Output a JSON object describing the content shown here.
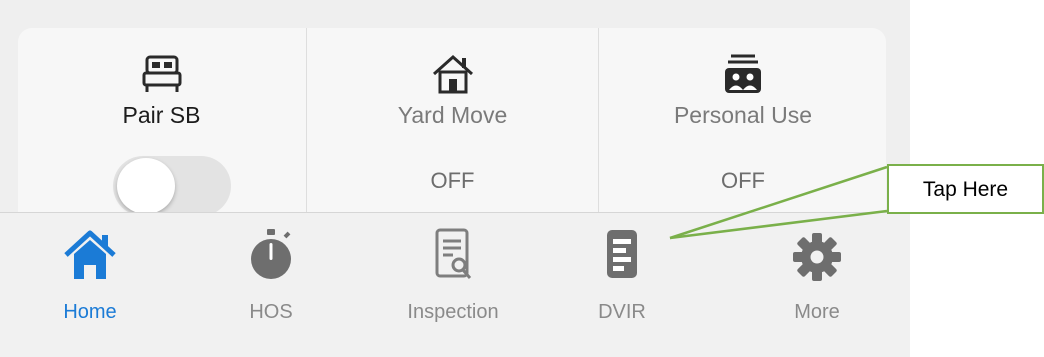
{
  "status_card": {
    "pair_sb": {
      "label": "Pair SB",
      "toggle_on": false,
      "icon": "bed-icon"
    },
    "yard_move": {
      "label": "Yard Move",
      "value": "OFF",
      "icon": "house-icon"
    },
    "personal_use": {
      "label": "Personal Use",
      "value": "OFF",
      "icon": "personal-use-icon"
    }
  },
  "tabbar": {
    "items": [
      {
        "label": "Home",
        "icon": "home-icon",
        "active": true
      },
      {
        "label": "HOS",
        "icon": "stopwatch-icon"
      },
      {
        "label": "Inspection",
        "icon": "inspection-icon"
      },
      {
        "label": "DVIR",
        "icon": "dvir-icon"
      },
      {
        "label": "More",
        "icon": "gear-icon"
      }
    ]
  },
  "callout": {
    "text": "Tap Here"
  },
  "colors": {
    "accent": "#1b7bd6",
    "inactive": "#8a8a8a",
    "callout_border": "#7ab04a"
  }
}
